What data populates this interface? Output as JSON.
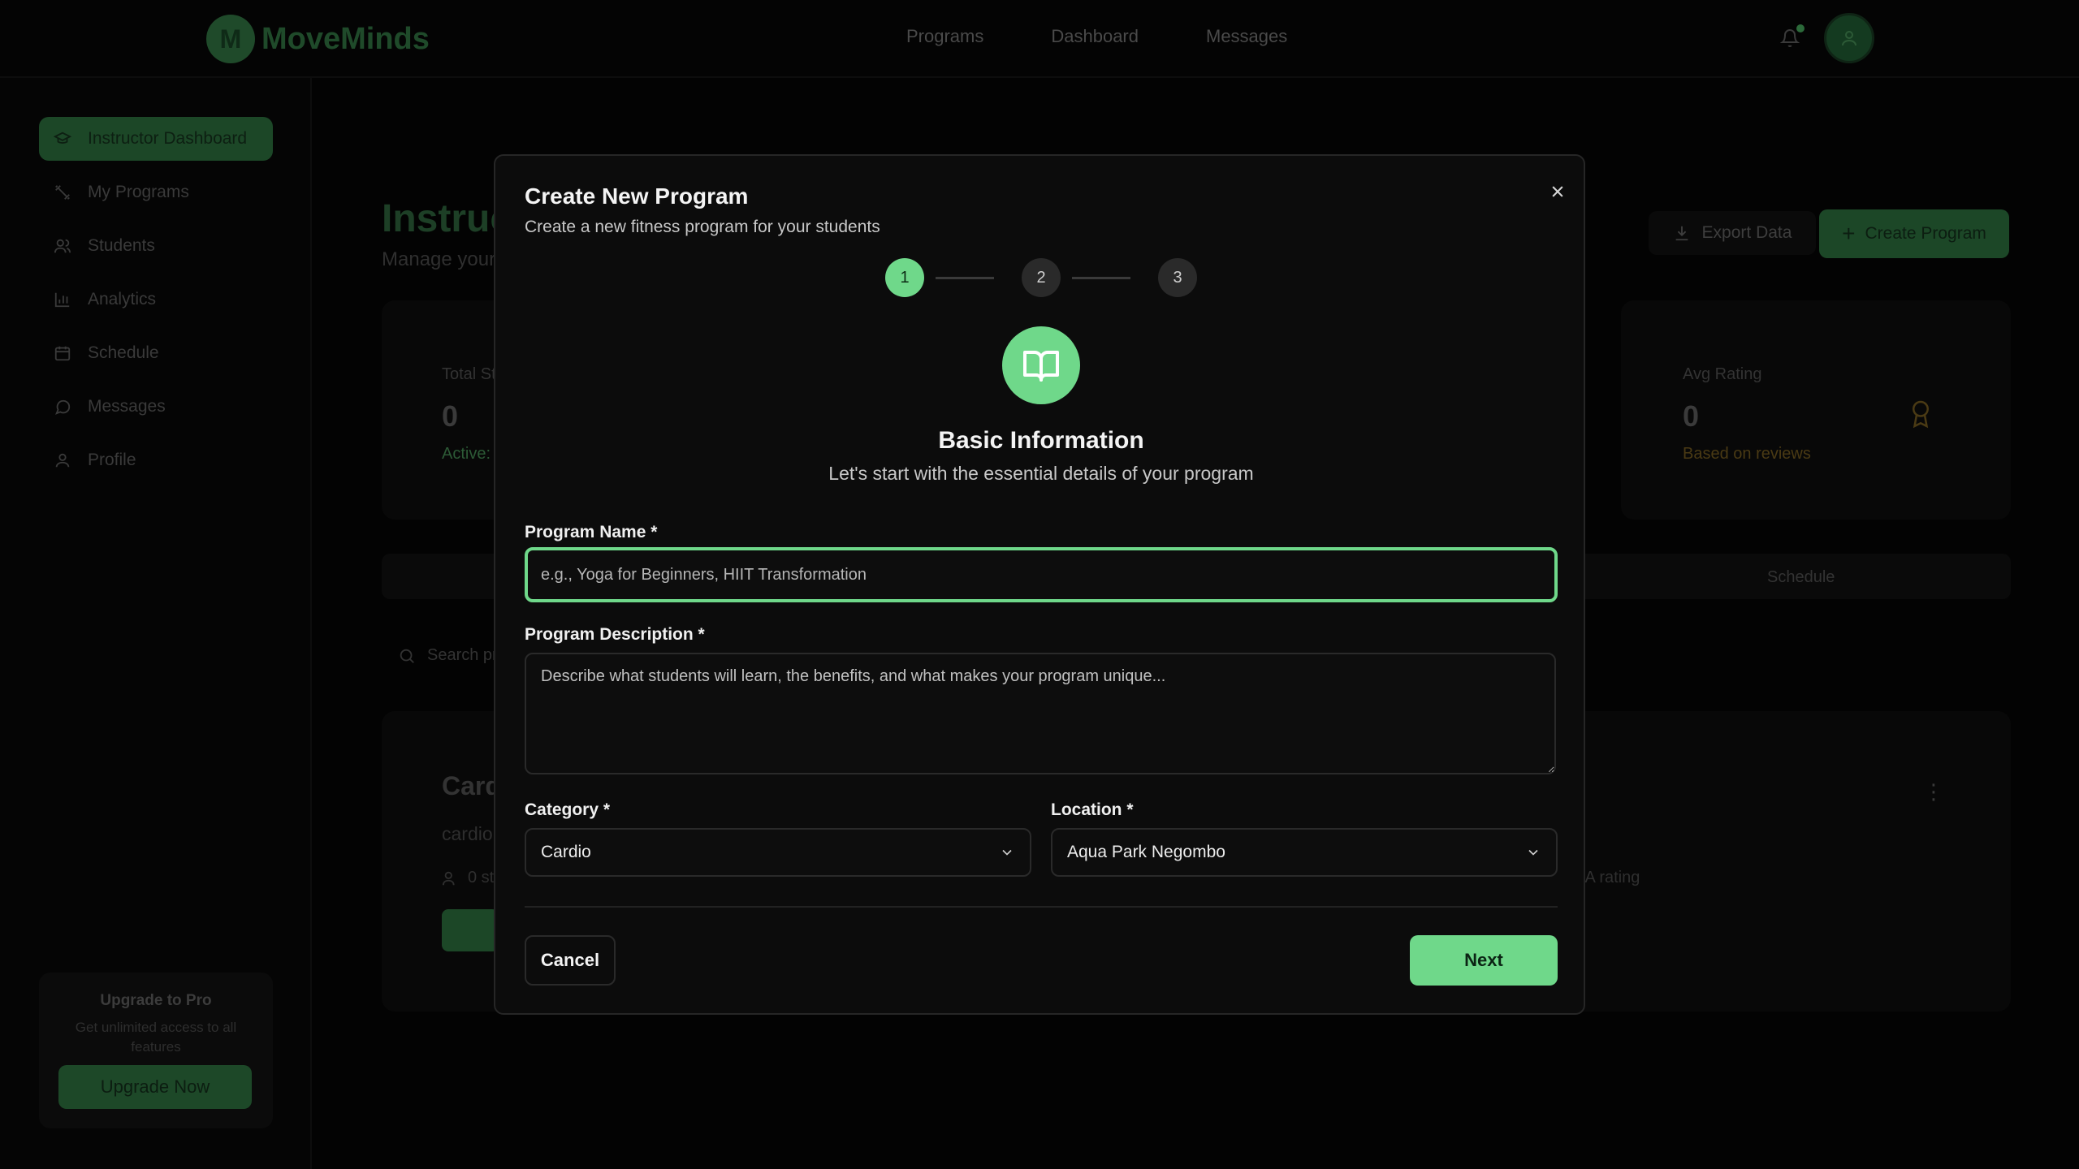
{
  "app": {
    "brand_initial": "M",
    "brand_name": "MoveMinds"
  },
  "topnav": {
    "items": [
      {
        "label": "Programs"
      },
      {
        "label": "Dashboard"
      },
      {
        "label": "Messages"
      }
    ]
  },
  "sidebar": {
    "items": [
      {
        "label": "Instructor Dashboard",
        "icon": "graduation-cap-icon",
        "active": true
      },
      {
        "label": "My Programs",
        "icon": "dumbbell-icon"
      },
      {
        "label": "Students",
        "icon": "users-icon"
      },
      {
        "label": "Analytics",
        "icon": "bar-chart-icon"
      },
      {
        "label": "Schedule",
        "icon": "calendar-icon"
      },
      {
        "label": "Messages",
        "icon": "message-icon"
      },
      {
        "label": "Profile",
        "icon": "user-icon"
      }
    ],
    "upgrade": {
      "title": "Upgrade to Pro",
      "subtitle": "Get unlimited access to all features",
      "button": "Upgrade Now"
    }
  },
  "main": {
    "title": "Instruc",
    "subtitle": "Manage your",
    "export_label": "Export Data",
    "create_label": "Create Program",
    "stats": {
      "total": {
        "label": "Total St",
        "value": "0",
        "foot": "Active:"
      },
      "rating": {
        "label": "Avg Rating",
        "value": "0",
        "foot": "Based on reviews"
      }
    },
    "tab_schedule": "Schedule",
    "search_placeholder": "Search pr",
    "program": {
      "title": "Card",
      "category": "cardio",
      "students": "0 st",
      "rating": "/A rating"
    }
  },
  "modal": {
    "title": "Create New Program",
    "subtitle": "Create a new fitness program for your students",
    "steps": [
      "1",
      "2",
      "3"
    ],
    "current_step": 1,
    "section_title": "Basic Information",
    "section_subtitle": "Let's start with the essential details of your program",
    "fields": {
      "name": {
        "label": "Program Name *",
        "placeholder": "e.g., Yoga for Beginners, HIIT Transformation",
        "value": ""
      },
      "description": {
        "label": "Program Description *",
        "placeholder": "Describe what students will learn, the benefits, and what makes your program unique...",
        "value": ""
      },
      "category": {
        "label": "Category *",
        "value": "Cardio"
      },
      "location": {
        "label": "Location *",
        "value": "Aqua Park Negombo"
      }
    },
    "cancel_label": "Cancel",
    "next_label": "Next"
  },
  "colors": {
    "accent": "#6fd88a",
    "modal_bg": "#0c0c0c",
    "page_bg": "#030303"
  }
}
